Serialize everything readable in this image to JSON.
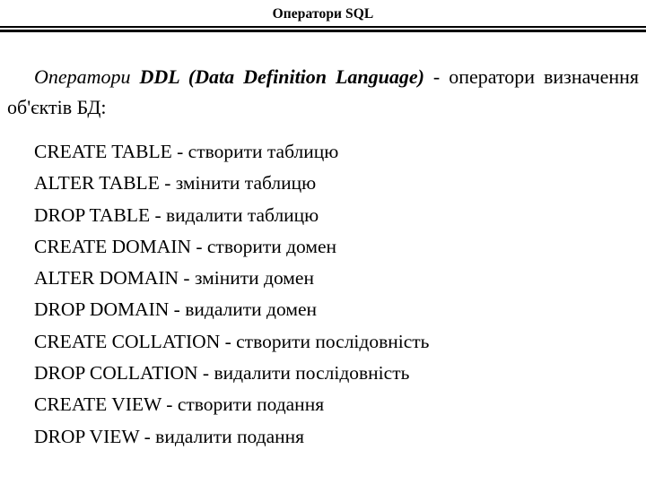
{
  "slide": {
    "title": "Оператори SQL",
    "theme": {
      "background_color": "#ffffff",
      "text_color": "#000000",
      "rule_color": "#000000"
    },
    "intro": {
      "lead_italic": "Оператори ",
      "term_bold_italic": "DDL (Data Definition Language)",
      "tail": " - оператори визначення об'єктів БД:",
      "full_text": "Оператори DDL (Data Definition Language) - оператори визначення об'єктів БД:"
    },
    "ddl_items": [
      {
        "statement": "CREATE TABLE",
        "description": "створити таблицю",
        "text": "CREATE TABLE - створити таблицю"
      },
      {
        "statement": "ALTER TABLE",
        "description": "змінити таблицю",
        "text": "ALTER TABLE - змінити таблицю"
      },
      {
        "statement": "DROP TABLE",
        "description": "видалити таблицю",
        "text": "DROP TABLE - видалити таблицю"
      },
      {
        "statement": "CREATE DOMAIN",
        "description": "створити домен",
        "text": "CREATE DOMAIN - створити домен"
      },
      {
        "statement": "ALTER DOMAIN",
        "description": "змінити домен",
        "text": "ALTER DOMAIN - змінити домен"
      },
      {
        "statement": "DROP DOMAIN",
        "description": "видалити домен",
        "text": "DROP DOMAIN - видалити домен"
      },
      {
        "statement": "CREATE COLLATION",
        "description": "створити послідовність",
        "text": "CREATE COLLATION - створити послідовність"
      },
      {
        "statement": "DROP COLLATION",
        "description": "видалити послідовність",
        "text": "DROP COLLATION - видалити послідовність"
      },
      {
        "statement": "CREATE VIEW",
        "description": "створити подання",
        "text": "CREATE VIEW - створити подання"
      },
      {
        "statement": "DROP VIEW",
        "description": "видалити подання",
        "text": "DROP VIEW - видалити подання"
      }
    ]
  }
}
